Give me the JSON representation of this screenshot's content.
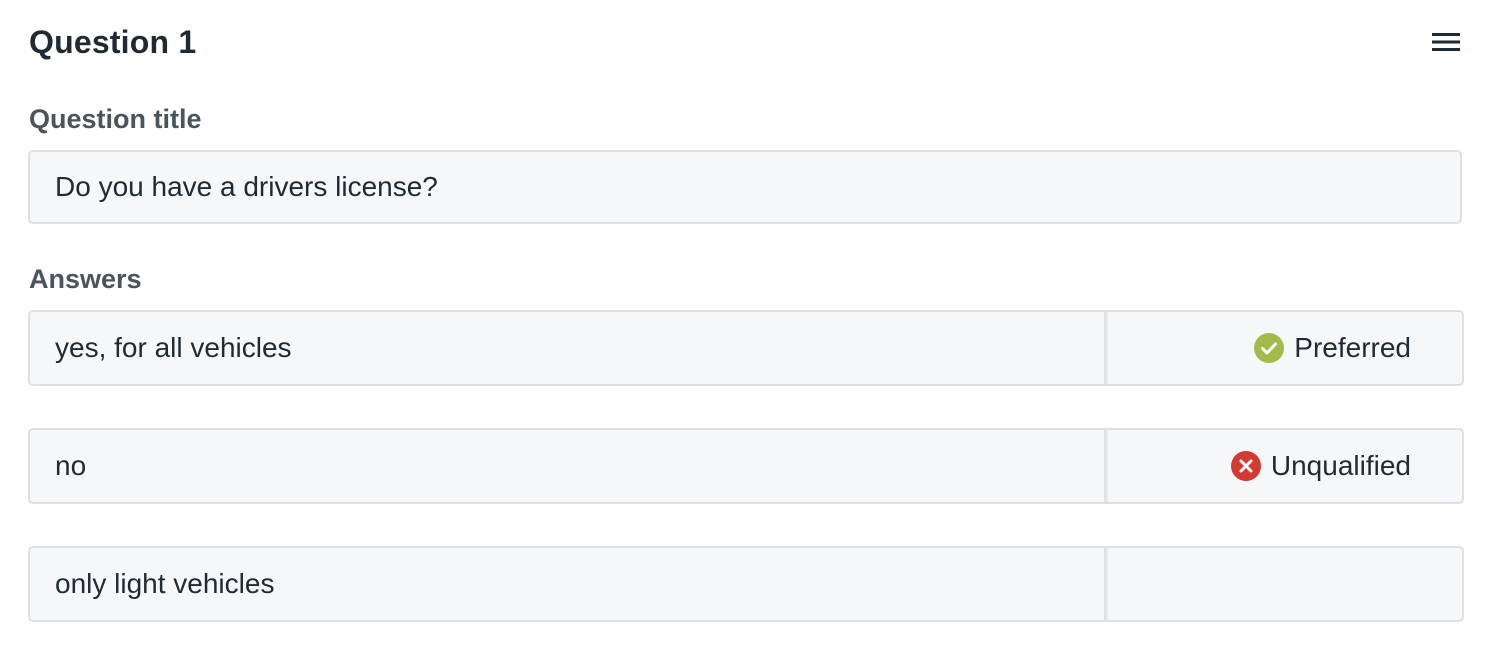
{
  "header": {
    "title": "Question 1",
    "menu_icon": "hamburger-menu-icon"
  },
  "question": {
    "title_label": "Question title",
    "title_value": "Do you have a drivers license?"
  },
  "answers": {
    "label": "Answers",
    "items": [
      {
        "text": "yes, for all vehicles",
        "status": "Preferred",
        "status_icon": "check-circle-icon",
        "status_color": "#a4bb4a"
      },
      {
        "text": "no",
        "status": "Unqualified",
        "status_icon": "x-circle-icon",
        "status_color": "#d23a32"
      },
      {
        "text": "only light vehicles",
        "status": "",
        "status_icon": "",
        "status_color": ""
      }
    ]
  }
}
